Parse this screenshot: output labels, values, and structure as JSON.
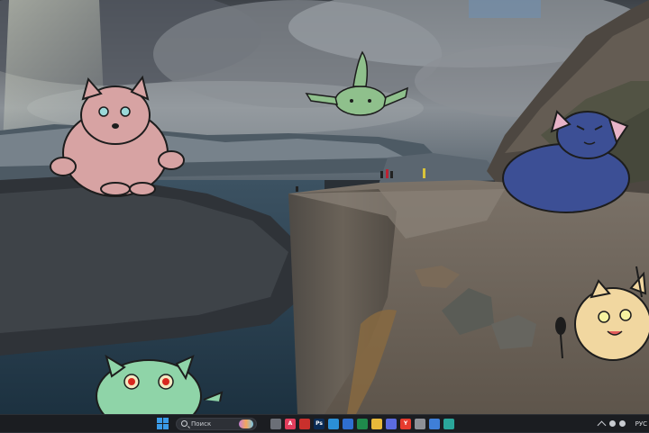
{
  "desktop": {
    "wallpaper": "cliff-over-fjord-with-cartoon-cats",
    "colors": {
      "sky": "#6b6f74",
      "fjord": "#2f4a5c",
      "cliff": "#6a6258",
      "cat_pink": "#d7a3a3",
      "cat_green_float": "#8fc08c",
      "cat_blue": "#3c4f95",
      "cat_yellow": "#f1d7a0",
      "cat_green_bottom": "#8fd4a8"
    }
  },
  "taskbar": {
    "search": {
      "placeholder": "Поиск",
      "icon": "search-icon"
    },
    "apps": [
      {
        "name": "widgets",
        "glyph": "",
        "color": "#6b6f77"
      },
      {
        "name": "app-red-a",
        "glyph": "A",
        "color": "#e23d5c"
      },
      {
        "name": "acrobat",
        "glyph": "",
        "color": "#c9302c"
      },
      {
        "name": "photoshop",
        "glyph": "Ps",
        "color": "#0b2c56"
      },
      {
        "name": "edge",
        "glyph": "",
        "color": "#2b8fd6"
      },
      {
        "name": "word",
        "glyph": "",
        "color": "#2f6fd0"
      },
      {
        "name": "excel",
        "glyph": "",
        "color": "#1f8a4c"
      },
      {
        "name": "file-explorer",
        "glyph": "",
        "color": "#e8b93a"
      },
      {
        "name": "app-color",
        "glyph": "",
        "color": "#5b6be0"
      },
      {
        "name": "yandex-browser",
        "glyph": "Y",
        "color": "#e63b2e"
      },
      {
        "name": "app-grey",
        "glyph": "",
        "color": "#8d9097"
      },
      {
        "name": "photos",
        "glyph": "",
        "color": "#3f7fd8"
      },
      {
        "name": "app-teal",
        "glyph": "",
        "color": "#2aa69a"
      }
    ],
    "tray": {
      "language": "РУС"
    }
  }
}
